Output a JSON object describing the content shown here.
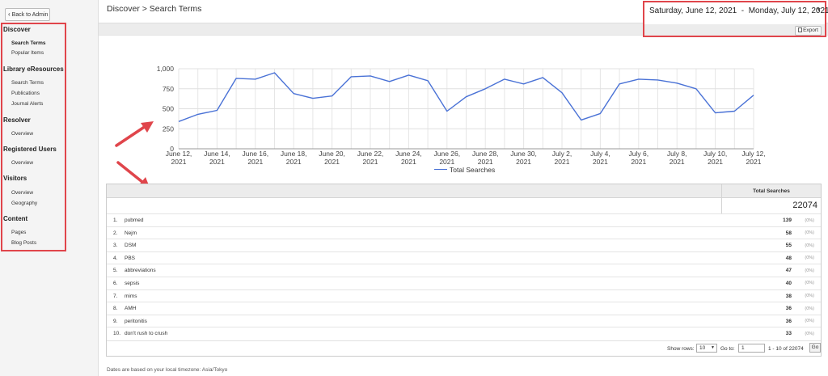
{
  "sidebar": {
    "back_label": "Back to Admin",
    "sections": [
      {
        "title": "Discover",
        "items": [
          "Search Terms",
          "Popular Items"
        ]
      },
      {
        "title": "Library eResources",
        "items": [
          "Search Terms",
          "Publications",
          "Journal Alerts"
        ]
      },
      {
        "title": "Resolver",
        "items": [
          "Overview"
        ]
      },
      {
        "title": "Registered Users",
        "items": [
          "Overview"
        ]
      },
      {
        "title": "Visitors",
        "items": [
          "Overview",
          "Geography"
        ]
      },
      {
        "title": "Content",
        "items": [
          "Pages",
          "Blog Posts"
        ]
      }
    ]
  },
  "header": {
    "breadcrumb": "Discover > Search Terms",
    "date_start": "Saturday, June 12, 2021",
    "date_sep": "-",
    "date_end": "Monday, July 12, 2021",
    "export_label": "Export"
  },
  "colors": {
    "highlight": "#e0454b",
    "line": "#4a72d6",
    "arrow": "#e0454b"
  },
  "chart_data": {
    "type": "line",
    "x": [
      "June 12, 2021",
      "June 13, 2021",
      "June 14, 2021",
      "June 15, 2021",
      "June 16, 2021",
      "June 17, 2021",
      "June 18, 2021",
      "June 19, 2021",
      "June 20, 2021",
      "June 21, 2021",
      "June 22, 2021",
      "June 23, 2021",
      "June 24, 2021",
      "June 25, 2021",
      "June 26, 2021",
      "June 27, 2021",
      "June 28, 2021",
      "June 29, 2021",
      "June 30, 2021",
      "July 1, 2021",
      "July 2, 2021",
      "July 3, 2021",
      "July 4, 2021",
      "July 5, 2021",
      "July 6, 2021",
      "July 7, 2021",
      "July 8, 2021",
      "July 9, 2021",
      "July 10, 2021",
      "July 11, 2021",
      "July 12, 2021"
    ],
    "series": [
      {
        "name": "Total Searches",
        "values": [
          340,
          430,
          480,
          880,
          870,
          950,
          690,
          630,
          660,
          900,
          910,
          840,
          920,
          850,
          470,
          650,
          750,
          870,
          810,
          890,
          700,
          360,
          440,
          810,
          870,
          860,
          820,
          750,
          450,
          470,
          670
        ]
      }
    ],
    "xtick_labels": [
      [
        "June 12,",
        "2021"
      ],
      [
        "June 14,",
        "2021"
      ],
      [
        "June 16,",
        "2021"
      ],
      [
        "June 18,",
        "2021"
      ],
      [
        "June 20,",
        "2021"
      ],
      [
        "June 22,",
        "2021"
      ],
      [
        "June 24,",
        "2021"
      ],
      [
        "June 26,",
        "2021"
      ],
      [
        "June 28,",
        "2021"
      ],
      [
        "June 30,",
        "2021"
      ],
      [
        "July 2,",
        "2021"
      ],
      [
        "July 4,",
        "2021"
      ],
      [
        "July 6,",
        "2021"
      ],
      [
        "July 8,",
        "2021"
      ],
      [
        "July 10,",
        "2021"
      ],
      [
        "July 12,",
        "2021"
      ]
    ],
    "ytick_labels": [
      "0",
      "250",
      "500",
      "750",
      "1,000"
    ],
    "ylim": [
      0,
      1000
    ],
    "grid": true,
    "legend": "bottom"
  },
  "table": {
    "column_header": "Total Searches",
    "total": "22074",
    "rows": [
      {
        "rank": "1.",
        "term": "pubmed",
        "count": "139",
        "pct": "(0%)"
      },
      {
        "rank": "2.",
        "term": "Nejm",
        "count": "58",
        "pct": "(0%)"
      },
      {
        "rank": "3.",
        "term": "DSM",
        "count": "55",
        "pct": "(0%)"
      },
      {
        "rank": "4.",
        "term": "PBS",
        "count": "48",
        "pct": "(0%)"
      },
      {
        "rank": "5.",
        "term": "abbreviations",
        "count": "47",
        "pct": "(0%)"
      },
      {
        "rank": "6.",
        "term": "sepsis",
        "count": "40",
        "pct": "(0%)"
      },
      {
        "rank": "7.",
        "term": "mims",
        "count": "38",
        "pct": "(0%)"
      },
      {
        "rank": "8.",
        "term": "AMH",
        "count": "36",
        "pct": "(0%)"
      },
      {
        "rank": "9.",
        "term": "peritonitis",
        "count": "36",
        "pct": "(0%)"
      },
      {
        "rank": "10.",
        "term": "don't rush to crush",
        "count": "33",
        "pct": "(0%)"
      }
    ]
  },
  "pager": {
    "show_rows_label": "Show rows:",
    "rows_value": "10",
    "goto_label": "Go to:",
    "goto_value": "1",
    "range_text": "1 - 10 of 22074",
    "go_label": "Go"
  },
  "footnote": "Dates are based on your local timezone: Asia/Tokyo"
}
